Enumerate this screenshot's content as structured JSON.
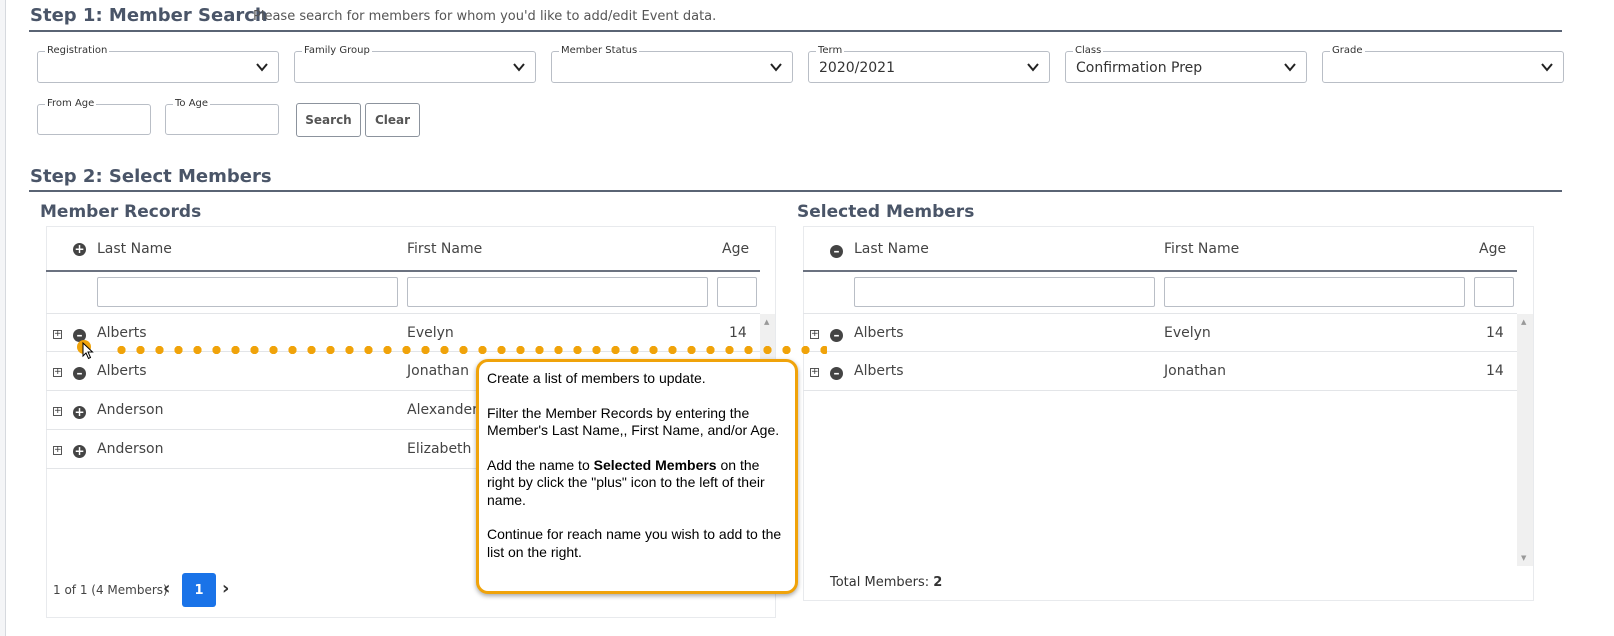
{
  "step1": {
    "title": "Step 1: Member Search",
    "subtitle": "Please search for members for whom you'd like to add/edit Event data."
  },
  "filters": [
    {
      "label": "Registration",
      "value": ""
    },
    {
      "label": "Family Group",
      "value": ""
    },
    {
      "label": "Member Status",
      "value": ""
    },
    {
      "label": "Term",
      "value": "2020/2021"
    },
    {
      "label": "Class",
      "value": "Confirmation Prep"
    },
    {
      "label": "Grade",
      "value": ""
    }
  ],
  "age_filters": {
    "from_label": "From Age",
    "to_label": "To Age"
  },
  "buttons": {
    "search": "Search",
    "clear": "Clear"
  },
  "step2": {
    "title": "Step 2: Select Members"
  },
  "member_records": {
    "title": "Member Records",
    "columns": {
      "last": "Last Name",
      "first": "First Name",
      "age": "Age"
    },
    "rows": [
      {
        "last": "Alberts",
        "first": "Evelyn",
        "age": "14",
        "action": "minus"
      },
      {
        "last": "Alberts",
        "first": "Jonathan",
        "age": "",
        "action": "minus"
      },
      {
        "last": "Anderson",
        "first": "Alexander",
        "age": "",
        "action": "plus"
      },
      {
        "last": "Anderson",
        "first": "Elizabeth",
        "age": "",
        "action": "plus"
      }
    ],
    "pager_text": "1 of 1 (4 Members)",
    "current_page": "1"
  },
  "selected_members": {
    "title": "Selected Members",
    "columns": {
      "last": "Last Name",
      "first": "First Name",
      "age": "Age"
    },
    "rows": [
      {
        "last": "Alberts",
        "first": "Evelyn",
        "age": "14"
      },
      {
        "last": "Alberts",
        "first": "Jonathan",
        "age": "14"
      }
    ],
    "total_label": "Total Members:",
    "total_value": "2"
  },
  "callout": {
    "p1": "Create a list of members to update.",
    "p2": "Filter the Member Records by entering the Member's Last Name,, First Name, and/or Age.",
    "p3_pre": "Add the name to ",
    "p3_bold": "Selected Members",
    "p3_post": " on the right by click the \"plus\" icon to the left of their name.",
    "p4": "Continue for reach name you wish to add to the list on the right."
  },
  "colors": {
    "accent": "#1a73e8",
    "callout_border": "#f0a30a",
    "heading": "#4a5568"
  }
}
